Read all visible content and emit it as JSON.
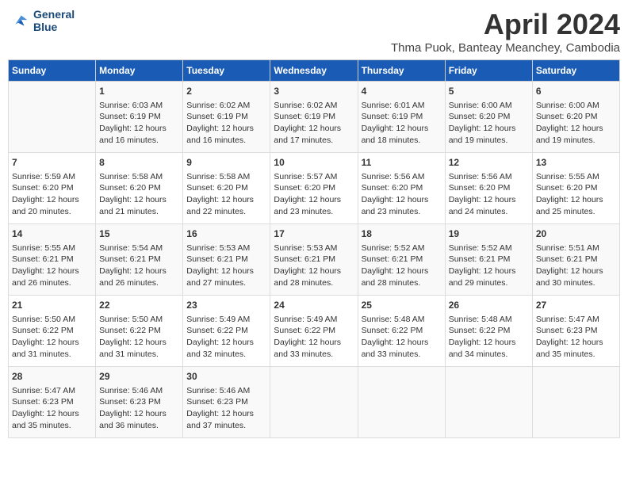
{
  "header": {
    "logo_line1": "General",
    "logo_line2": "Blue",
    "title": "April 2024",
    "subtitle": "Thma Puok, Banteay Meanchey, Cambodia"
  },
  "calendar": {
    "days_of_week": [
      "Sunday",
      "Monday",
      "Tuesday",
      "Wednesday",
      "Thursday",
      "Friday",
      "Saturday"
    ],
    "weeks": [
      [
        {
          "day": "",
          "info": ""
        },
        {
          "day": "1",
          "info": "Sunrise: 6:03 AM\nSunset: 6:19 PM\nDaylight: 12 hours\nand 16 minutes."
        },
        {
          "day": "2",
          "info": "Sunrise: 6:02 AM\nSunset: 6:19 PM\nDaylight: 12 hours\nand 16 minutes."
        },
        {
          "day": "3",
          "info": "Sunrise: 6:02 AM\nSunset: 6:19 PM\nDaylight: 12 hours\nand 17 minutes."
        },
        {
          "day": "4",
          "info": "Sunrise: 6:01 AM\nSunset: 6:19 PM\nDaylight: 12 hours\nand 18 minutes."
        },
        {
          "day": "5",
          "info": "Sunrise: 6:00 AM\nSunset: 6:20 PM\nDaylight: 12 hours\nand 19 minutes."
        },
        {
          "day": "6",
          "info": "Sunrise: 6:00 AM\nSunset: 6:20 PM\nDaylight: 12 hours\nand 19 minutes."
        }
      ],
      [
        {
          "day": "7",
          "info": "Sunrise: 5:59 AM\nSunset: 6:20 PM\nDaylight: 12 hours\nand 20 minutes."
        },
        {
          "day": "8",
          "info": "Sunrise: 5:58 AM\nSunset: 6:20 PM\nDaylight: 12 hours\nand 21 minutes."
        },
        {
          "day": "9",
          "info": "Sunrise: 5:58 AM\nSunset: 6:20 PM\nDaylight: 12 hours\nand 22 minutes."
        },
        {
          "day": "10",
          "info": "Sunrise: 5:57 AM\nSunset: 6:20 PM\nDaylight: 12 hours\nand 23 minutes."
        },
        {
          "day": "11",
          "info": "Sunrise: 5:56 AM\nSunset: 6:20 PM\nDaylight: 12 hours\nand 23 minutes."
        },
        {
          "day": "12",
          "info": "Sunrise: 5:56 AM\nSunset: 6:20 PM\nDaylight: 12 hours\nand 24 minutes."
        },
        {
          "day": "13",
          "info": "Sunrise: 5:55 AM\nSunset: 6:20 PM\nDaylight: 12 hours\nand 25 minutes."
        }
      ],
      [
        {
          "day": "14",
          "info": "Sunrise: 5:55 AM\nSunset: 6:21 PM\nDaylight: 12 hours\nand 26 minutes."
        },
        {
          "day": "15",
          "info": "Sunrise: 5:54 AM\nSunset: 6:21 PM\nDaylight: 12 hours\nand 26 minutes."
        },
        {
          "day": "16",
          "info": "Sunrise: 5:53 AM\nSunset: 6:21 PM\nDaylight: 12 hours\nand 27 minutes."
        },
        {
          "day": "17",
          "info": "Sunrise: 5:53 AM\nSunset: 6:21 PM\nDaylight: 12 hours\nand 28 minutes."
        },
        {
          "day": "18",
          "info": "Sunrise: 5:52 AM\nSunset: 6:21 PM\nDaylight: 12 hours\nand 28 minutes."
        },
        {
          "day": "19",
          "info": "Sunrise: 5:52 AM\nSunset: 6:21 PM\nDaylight: 12 hours\nand 29 minutes."
        },
        {
          "day": "20",
          "info": "Sunrise: 5:51 AM\nSunset: 6:21 PM\nDaylight: 12 hours\nand 30 minutes."
        }
      ],
      [
        {
          "day": "21",
          "info": "Sunrise: 5:50 AM\nSunset: 6:22 PM\nDaylight: 12 hours\nand 31 minutes."
        },
        {
          "day": "22",
          "info": "Sunrise: 5:50 AM\nSunset: 6:22 PM\nDaylight: 12 hours\nand 31 minutes."
        },
        {
          "day": "23",
          "info": "Sunrise: 5:49 AM\nSunset: 6:22 PM\nDaylight: 12 hours\nand 32 minutes."
        },
        {
          "day": "24",
          "info": "Sunrise: 5:49 AM\nSunset: 6:22 PM\nDaylight: 12 hours\nand 33 minutes."
        },
        {
          "day": "25",
          "info": "Sunrise: 5:48 AM\nSunset: 6:22 PM\nDaylight: 12 hours\nand 33 minutes."
        },
        {
          "day": "26",
          "info": "Sunrise: 5:48 AM\nSunset: 6:22 PM\nDaylight: 12 hours\nand 34 minutes."
        },
        {
          "day": "27",
          "info": "Sunrise: 5:47 AM\nSunset: 6:23 PM\nDaylight: 12 hours\nand 35 minutes."
        }
      ],
      [
        {
          "day": "28",
          "info": "Sunrise: 5:47 AM\nSunset: 6:23 PM\nDaylight: 12 hours\nand 35 minutes."
        },
        {
          "day": "29",
          "info": "Sunrise: 5:46 AM\nSunset: 6:23 PM\nDaylight: 12 hours\nand 36 minutes."
        },
        {
          "day": "30",
          "info": "Sunrise: 5:46 AM\nSunset: 6:23 PM\nDaylight: 12 hours\nand 37 minutes."
        },
        {
          "day": "",
          "info": ""
        },
        {
          "day": "",
          "info": ""
        },
        {
          "day": "",
          "info": ""
        },
        {
          "day": "",
          "info": ""
        }
      ]
    ]
  }
}
